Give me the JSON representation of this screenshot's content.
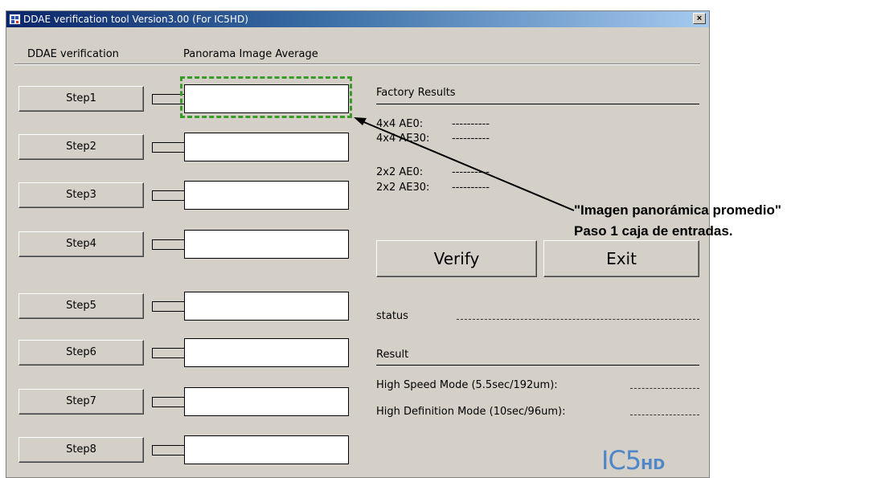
{
  "window": {
    "title": "DDAE verification tool Version3.00 (For IC5HD)",
    "close_label": "×"
  },
  "tabs": [
    {
      "label": "DDAE verification"
    },
    {
      "label": "Panorama Image Average"
    }
  ],
  "steps": [
    {
      "label": "Step1",
      "value": ""
    },
    {
      "label": "Step2",
      "value": ""
    },
    {
      "label": "Step3",
      "value": ""
    },
    {
      "label": "Step4",
      "value": ""
    },
    {
      "label": "Step5",
      "value": ""
    },
    {
      "label": "Step6",
      "value": ""
    },
    {
      "label": "Step7",
      "value": ""
    },
    {
      "label": "Step8",
      "value": ""
    }
  ],
  "factory": {
    "title": "Factory Results",
    "rows": [
      {
        "label": "4x4 AE0:",
        "value": "----------"
      },
      {
        "label": "4x4 AE30:",
        "value": "----------"
      },
      {
        "label": "2x2 AE0:",
        "value": "----------"
      },
      {
        "label": "2x2 AE30:",
        "value": "----------"
      }
    ]
  },
  "buttons": {
    "verify": "Verify",
    "exit": "Exit"
  },
  "status": {
    "label": "status"
  },
  "result": {
    "title": "Result",
    "rows": [
      {
        "label": "High Speed Mode  (5.5sec/192um):"
      },
      {
        "label": "High Definition Mode (10sec/96um):"
      }
    ]
  },
  "logo": {
    "main": "IC5",
    "sub": "HD"
  },
  "annotation": {
    "line1": "\"Imagen panorámica promedio\"",
    "line2": "Paso 1 caja de entradas."
  },
  "colors": {
    "title_bar_start": "#0a246a",
    "title_bar_end": "#a6caf0",
    "highlight": "#3a9a2a",
    "logo": "#4f86c8",
    "face": "#d4d0c8"
  }
}
